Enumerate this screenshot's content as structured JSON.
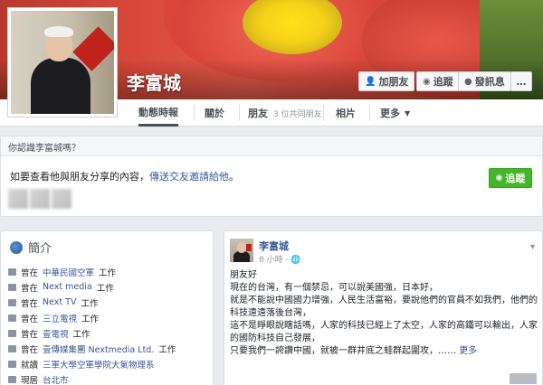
{
  "profile": {
    "name": "李富城"
  },
  "header": {
    "add_friend": "加朋友",
    "follow": "追蹤",
    "message": "發訊息"
  },
  "tabs": {
    "timeline": "動態時報",
    "about": "關於",
    "friends": "朋友",
    "friends_sub": "3 位共同朋友",
    "photos": "相片",
    "more": "更多"
  },
  "know": {
    "question": "你認識李富城嗎？",
    "text_prefix": "如要查看他與朋友分享的內容，",
    "link": "傳送交友邀請給他",
    "text_suffix": "。",
    "follow_btn": "追蹤"
  },
  "intro": {
    "title": "簡介",
    "items": [
      {
        "pre": "曾在",
        "link": "中華民國空軍",
        "post": "工作"
      },
      {
        "pre": "曾在",
        "link": "Next media",
        "post": "工作"
      },
      {
        "pre": "曾在",
        "link": "Next TV",
        "post": "工作"
      },
      {
        "pre": "曾在",
        "link": "三立電視",
        "post": "工作"
      },
      {
        "pre": "曾在",
        "link": "壹電視",
        "post": "工作"
      },
      {
        "pre": "曾在",
        "link": "壹傳媒集團 Nextmedia Ltd.",
        "post": "工作"
      },
      {
        "pre": "就讀",
        "link": "三軍大學空軍學院大氣物理系",
        "post": ""
      },
      {
        "pre": "現居",
        "link": "台北市",
        "post": ""
      }
    ]
  },
  "post": {
    "author": "李富城",
    "time": "8 小時 · ",
    "lines": [
      "朋友好",
      "現在的台灣，有一個禁忌，可以說美國強，日本好，",
      "就是不能說中國國力增強，人民生活富裕，要說他們的官員不如我們，他們的科技遠遠落後台灣，",
      "這不是睜眼說瞎話嗎，人家的科技已經上了太空，人家的高鐵可以輸出，人家的國防科技自己發展，",
      "只要我們一誇讚中國，就被一群井底之蛙群起圍攻，"
    ],
    "ellipsis": "……",
    "more": "更多"
  }
}
